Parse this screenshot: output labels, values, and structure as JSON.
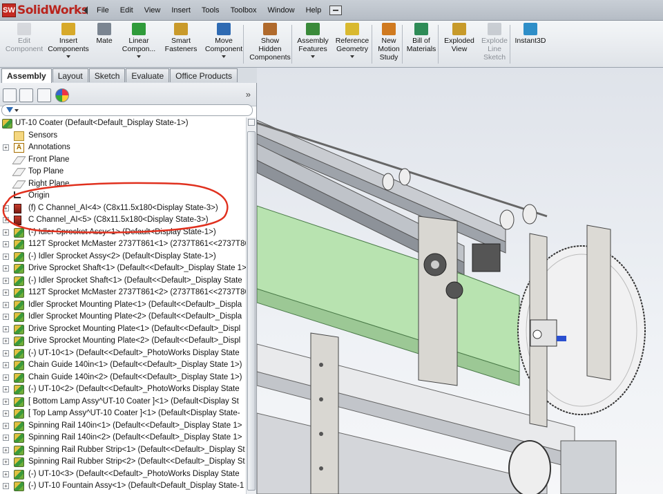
{
  "app": {
    "name": "SolidWorks",
    "logo_mark": "SW"
  },
  "menus": [
    "File",
    "Edit",
    "View",
    "Insert",
    "Tools",
    "Toolbox",
    "Window",
    "Help"
  ],
  "ribbon": {
    "commands": [
      {
        "label": "Edit\nComponent",
        "icon": "edit-component-icon",
        "enabled": false
      },
      {
        "label": "Insert\nComponents",
        "icon": "insert-components-icon",
        "enabled": true
      },
      {
        "label": "Mate",
        "icon": "mate-icon",
        "enabled": true
      },
      {
        "label": "Linear\nCompon...",
        "icon": "linear-pattern-icon",
        "enabled": true
      },
      {
        "label": "Smart\nFasteners",
        "icon": "smart-fasteners-icon",
        "enabled": true
      },
      {
        "label": "Move\nComponent",
        "icon": "move-component-icon",
        "enabled": true
      },
      {
        "label": "Show\nHidden\nComponents",
        "icon": "show-hidden-icon",
        "enabled": true
      },
      {
        "label": "Assembly\nFeatures",
        "icon": "assembly-features-icon",
        "enabled": true
      },
      {
        "label": "Reference\nGeometry",
        "icon": "reference-geometry-icon",
        "enabled": true
      },
      {
        "label": "New\nMotion\nStudy",
        "icon": "motion-study-icon",
        "enabled": true
      },
      {
        "label": "Bill of\nMaterials",
        "icon": "bom-icon",
        "enabled": true
      },
      {
        "label": "Exploded\nView",
        "icon": "exploded-view-icon",
        "enabled": true
      },
      {
        "label": "Explode\nLine\nSketch",
        "icon": "explode-line-icon",
        "enabled": false
      },
      {
        "label": "Instant3D",
        "icon": "instant3d-icon",
        "enabled": true
      }
    ]
  },
  "tabs": [
    "Assembly",
    "Layout",
    "Sketch",
    "Evaluate",
    "Office Products"
  ],
  "active_tab": "Assembly",
  "panel": {
    "expand_glyph": "»"
  },
  "tree": [
    {
      "label": "UT-10 Coater  (Default<Default_Display State-1>)",
      "icon": "assembly-icon",
      "level": 0,
      "expand": false
    },
    {
      "label": "Sensors",
      "icon": "sensor-icon",
      "level": 1,
      "expand": false
    },
    {
      "label": "Annotations",
      "icon": "annotation-icon",
      "level": 1,
      "expand": true
    },
    {
      "label": "Front Plane",
      "icon": "plane-icon",
      "level": 1,
      "expand": false
    },
    {
      "label": "Top Plane",
      "icon": "plane-icon",
      "level": 1,
      "expand": false
    },
    {
      "label": "Right Plane",
      "icon": "plane-icon",
      "level": 1,
      "expand": false
    },
    {
      "label": "Origin",
      "icon": "origin-icon",
      "level": 1,
      "expand": false
    },
    {
      "label": "(f) C Channel_AI<4> (C8x11.5x180<Display State-3>)",
      "icon": "part-icon",
      "level": 1,
      "expand": true
    },
    {
      "label": "C Channel_AI<5> (C8x11.5x180<Display State-3>)",
      "icon": "part-icon",
      "level": 1,
      "expand": true
    },
    {
      "label": "(-) Idler Sprocket Assy<1> (Default<Display State-1>)",
      "icon": "assembly-icon",
      "level": 1,
      "expand": true
    },
    {
      "label": "112T Sprocket McMaster 2737T861<1> (2737T861<<2737T861",
      "icon": "assembly-icon",
      "level": 1,
      "expand": true
    },
    {
      "label": "(-) Idler Sprocket Assy<2> (Default<Display State-1>)",
      "icon": "assembly-icon",
      "level": 1,
      "expand": true
    },
    {
      "label": "Drive Sprocket Shaft<1> (Default<<Default>_Display State 1>",
      "icon": "assembly-icon",
      "level": 1,
      "expand": true
    },
    {
      "label": "(-) Idler Sprocket Shaft<1> (Default<<Default>_Display State",
      "icon": "assembly-icon",
      "level": 1,
      "expand": true
    },
    {
      "label": "112T Sprocket McMaster 2737T861<2> (2737T861<<2737T86",
      "icon": "assembly-icon",
      "level": 1,
      "expand": true
    },
    {
      "label": "Idler Sprocket Mounting Plate<1> (Default<<Default>_Displa",
      "icon": "assembly-icon",
      "level": 1,
      "expand": true
    },
    {
      "label": "Idler Sprocket Mounting Plate<2> (Default<<Default>_Displa",
      "icon": "assembly-icon",
      "level": 1,
      "expand": true
    },
    {
      "label": "Drive Sprocket Mounting Plate<1> (Default<<Default>_Displ",
      "icon": "assembly-icon",
      "level": 1,
      "expand": true
    },
    {
      "label": "Drive Sprocket Mounting Plate<2> (Default<<Default>_Displ",
      "icon": "assembly-icon",
      "level": 1,
      "expand": true
    },
    {
      "label": "(-) UT-10<1> (Default<<Default>_PhotoWorks Display State",
      "icon": "assembly-icon",
      "level": 1,
      "expand": true
    },
    {
      "label": "Chain Guide 140in<1> (Default<<Default>_Display State 1>)",
      "icon": "assembly-icon",
      "level": 1,
      "expand": true
    },
    {
      "label": "Chain Guide 140in<2> (Default<<Default>_Display State 1>)",
      "icon": "assembly-icon",
      "level": 1,
      "expand": true
    },
    {
      "label": "(-) UT-10<2> (Default<<Default>_PhotoWorks Display State",
      "icon": "assembly-icon",
      "level": 1,
      "expand": true
    },
    {
      "label": "[ Bottom Lamp Assy^UT-10 Coater ]<1> (Default<Display St",
      "icon": "assembly-icon",
      "level": 1,
      "expand": true
    },
    {
      "label": "[ Top Lamp Assy^UT-10 Coater ]<1> (Default<Display State-",
      "icon": "assembly-icon",
      "level": 1,
      "expand": true
    },
    {
      "label": "Spinning Rail 140in<1> (Default<<Default>_Display State 1>",
      "icon": "assembly-icon",
      "level": 1,
      "expand": true
    },
    {
      "label": "Spinning Rail 140in<2> (Default<<Default>_Display State 1>",
      "icon": "assembly-icon",
      "level": 1,
      "expand": true
    },
    {
      "label": "Spinning Rail Rubber Strip<1> (Default<<Default>_Display St",
      "icon": "assembly-icon",
      "level": 1,
      "expand": true
    },
    {
      "label": "Spinning Rail Rubber Strip<2> (Default<<Default>_Display St",
      "icon": "assembly-icon",
      "level": 1,
      "expand": true
    },
    {
      "label": "(-) UT-10<3> (Default<<Default>_PhotoWorks Display State",
      "icon": "assembly-icon",
      "level": 1,
      "expand": true
    },
    {
      "label": "(-) UT-10 Fountain Assy<1> (Default<Default_Display State-1",
      "icon": "assembly-icon",
      "level": 1,
      "expand": true
    }
  ],
  "annotation": {
    "type": "hand-drawn-ellipse",
    "color": "#e0301e",
    "encircles": [
      "(f) C Channel_AI<4> (C8x11.5x180<Display State-3>)",
      "C Channel_AI<5> (C8x11.5x180<Display State-3>)"
    ]
  },
  "colors": {
    "logo_red": "#c42a22",
    "annotation_red": "#e0301e",
    "viewport_green": "#b8e3b0",
    "metal": "#b9bdc3"
  }
}
